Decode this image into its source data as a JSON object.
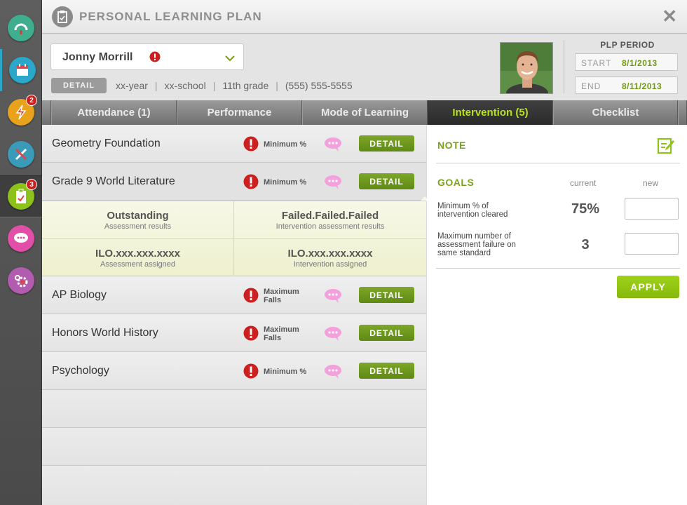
{
  "app": {
    "title": "PERSONAL LEARNING PLAN"
  },
  "sidebar": {
    "items": [
      {
        "icon": "gauge-icon",
        "color": "#3fae8e"
      },
      {
        "icon": "calendar-icon",
        "color": "#2aa7c9",
        "selected": true
      },
      {
        "icon": "lightning-icon",
        "color": "#e8a21c",
        "badge": "2"
      },
      {
        "icon": "tools-icon",
        "color": "#3a9bb8"
      },
      {
        "icon": "clipboard-icon",
        "color": "#8cc21a",
        "badge": "3",
        "active": true
      },
      {
        "icon": "chat-icon",
        "color": "#e24fa8"
      },
      {
        "icon": "settings-icon",
        "color": "#b25cb0"
      }
    ]
  },
  "student": {
    "name": "Jonny Morrill",
    "detail_label": "DETAIL",
    "year": "xx-year",
    "school": "xx-school",
    "grade": "11th grade",
    "phone": "(555) 555-5555"
  },
  "plp": {
    "title": "PLP PERIOD",
    "start_label": "START",
    "start": "8/1/2013",
    "end_label": "END",
    "end": "8/11/2013"
  },
  "tabs": [
    {
      "label": "Attendance (1)"
    },
    {
      "label": "Performance"
    },
    {
      "label": "Mode of Learning"
    },
    {
      "label": "Intervention (5)",
      "active": true
    },
    {
      "label": "Checklist"
    }
  ],
  "courses": [
    {
      "name": "Geometry Foundation",
      "status": "Minimum %",
      "detail": "DETAIL"
    },
    {
      "name": "Grade 9 World Literature",
      "status": "Minimum %",
      "detail": "DETAIL"
    },
    {
      "name": "AP Biology",
      "status": "Maximum Falls",
      "detail": "DETAIL"
    },
    {
      "name": "Honors World History",
      "status": "Maximum Falls",
      "detail": "DETAIL"
    },
    {
      "name": "Psychology",
      "status": "Minimum %",
      "detail": "DETAIL"
    }
  ],
  "expanded": {
    "cells": [
      {
        "value": "Outstanding",
        "caption": "Assessment results"
      },
      {
        "value": "Failed.Failed.Failed",
        "caption": "Intervention assessment results"
      },
      {
        "value": "ILO.xxx.xxx.xxxx",
        "caption": "Assessment assigned"
      },
      {
        "value": "ILO.xxx.xxx.xxxx",
        "caption": "Intervention assigned"
      }
    ]
  },
  "panel": {
    "note_label": "NOTE",
    "goals_label": "GOALS",
    "col_current": "current",
    "col_new": "new",
    "goals": [
      {
        "label": "Minimum % of intervention cleared",
        "current": "75%",
        "new": ""
      },
      {
        "label": "Maximum number of assessment failure on same standard",
        "current": "3",
        "new": ""
      }
    ],
    "apply_label": "APPLY"
  },
  "colors": {
    "accent_green": "#7aa21c",
    "active_tab_text": "#b9e31d",
    "alert_red": "#cc1f1f",
    "chat_pink": "#f08bd6"
  }
}
